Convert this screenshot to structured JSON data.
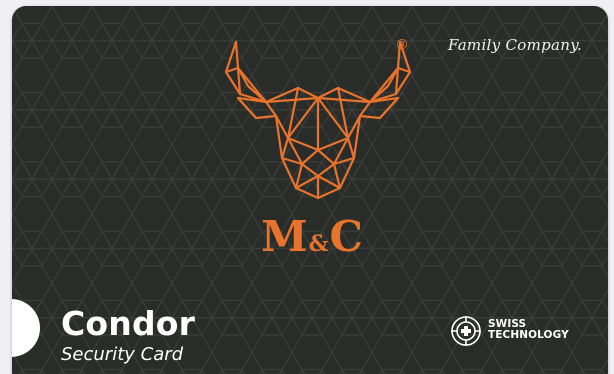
{
  "card": {
    "tagline": "Family Company.",
    "registered_mark": "®",
    "brand": {
      "letter_left": "M",
      "ampersand": "&",
      "letter_right": "C",
      "logo_icon": "bull-head-icon"
    },
    "product_name": "Condor",
    "product_subtitle": "Security Card",
    "badge": {
      "line1": "SWISS",
      "line2": "TECHNOLOGY",
      "icon": "crosshair-shield-icon"
    }
  },
  "colors": {
    "card_background": "#2a2c29",
    "accent_orange": "#e8732c",
    "text_white": "#ffffff",
    "page_background": "#f0f0f2"
  }
}
